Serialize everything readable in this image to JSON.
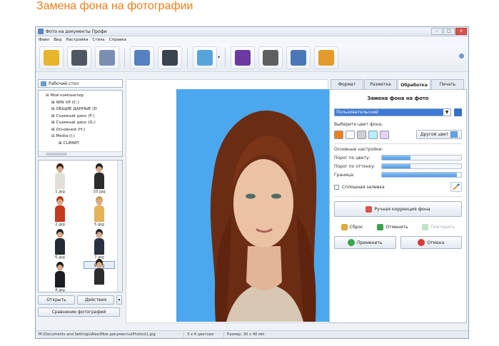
{
  "page_heading": "Замена фона на фотографии",
  "window": {
    "title": "Фото на документы Профи"
  },
  "menu": [
    "Файл",
    "Вид",
    "Настройки",
    "Стиль",
    "Справка"
  ],
  "toolbar": {
    "icons": [
      "open-folder-icon",
      "save-floppy-icon",
      "printer-icon",
      "person-icon",
      "camera-icon",
      "photo-correction-icon",
      "help-book-icon",
      "film-icon",
      "home-icon",
      "shop-cart-icon"
    ],
    "colors": [
      "#e8b42c",
      "#4f5862",
      "#7b8fb0",
      "#5580c2",
      "#3a4350",
      "#59a3dc",
      "#6a3aa0",
      "#5f5f5f",
      "#4b77b6",
      "#e59b2b"
    ]
  },
  "left": {
    "folder_select": "Рабочий стол",
    "tree": [
      {
        "label": "Мой компьютер",
        "level": 0
      },
      {
        "label": "WIN XP (C:)",
        "level": 1
      },
      {
        "label": "ОБЩИЕ ДАННЫЕ (D",
        "level": 1
      },
      {
        "label": "Съемный диск (F:)",
        "level": 1
      },
      {
        "label": "Съемный диск (G:)",
        "level": 1
      },
      {
        "label": "Основной (H:)",
        "level": 1
      },
      {
        "label": "Media (I:)",
        "level": 1
      },
      {
        "label": "CLIPART",
        "level": 2
      }
    ],
    "thumbnails": [
      {
        "label": "1.jpg",
        "hair": "#3b2416",
        "outfit": "#e2dfd8"
      },
      {
        "label": "10.jpg",
        "hair": "#1e1e1e",
        "outfit": "#2b2b2b"
      },
      {
        "label": "2.jpg",
        "hair": "#b43a10",
        "outfit": "#c43a1e"
      },
      {
        "label": "5.jpg",
        "hair": "#c9a24e",
        "outfit": "#e4b35a"
      },
      {
        "label": "6.jpg",
        "hair": "#222222",
        "outfit": "#252a33"
      },
      {
        "label": "7.jpg",
        "hair": "#2b2b2b",
        "outfit": "#2a3140"
      },
      {
        "label": "8.jpg",
        "hair": "#1a1a1a",
        "outfit": "#1b1d22"
      },
      {
        "label": "9.jpg",
        "hair": "#201a14",
        "outfit": "#2d2d2d"
      }
    ],
    "open_button": "Открыть",
    "actions_button": "Действия",
    "compare_button": "Сравнение фотографий"
  },
  "right": {
    "tabs": [
      "Формат",
      "Разметка",
      "Обработка",
      "Печать"
    ],
    "active_tab": "Обработка",
    "panel_title": "Замена фона на фото",
    "preset_value": "Пользовательский",
    "color_label": "Выберите цвет фона:",
    "swatches": [
      "#f07d1a",
      "#ffffff",
      "#cfcfcf",
      "#b8eefc",
      "#e6d3f3"
    ],
    "other_color_button": "Другой цвет",
    "other_color_value": "#5ba3ec",
    "settings_label": "Основные настройки:",
    "sliders": [
      {
        "label": "Порог по цвету:",
        "value": 0.36
      },
      {
        "label": "Порог по оттенку:",
        "value": 0.36
      },
      {
        "label": "Граница:",
        "value": 0.95
      }
    ],
    "solid_fill_label": "Сплошная заливка",
    "manual_button": "Ручная коррекция фона",
    "reset_label": "Сброс",
    "undo_label": "Отменить",
    "redo_label": "Повторить",
    "apply_button": "Применить",
    "cancel_button": "Отмена"
  },
  "status": {
    "path": "M:\\Documents and Settings\\Alex\\Мои документы\\Photos\\1.jpg",
    "format": "3 x 4 цветная",
    "size": "Размер: 30 x 40 мм"
  }
}
